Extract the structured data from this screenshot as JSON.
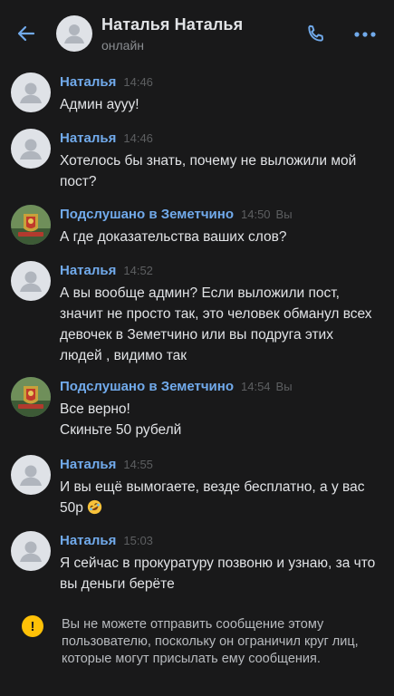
{
  "header": {
    "title": "Наталья Наталья",
    "status": "онлайн"
  },
  "colors": {
    "background": "#19191a",
    "author": "#71aaeb",
    "text": "#e1e3e6",
    "muted": "#5d5f61",
    "warning": "#ffc107"
  },
  "messages": [
    {
      "author": "Наталья",
      "time": "14:46",
      "you": "",
      "text": "Админ аууу!"
    },
    {
      "author": "Наталья",
      "time": "14:46",
      "you": "",
      "text": "Хотелось бы знать, почему не выложили мой пост?"
    },
    {
      "author": "Подслушано в Земетчино",
      "time": "14:50",
      "you": "Вы",
      "text": "А где доказательства ваших слов?"
    },
    {
      "author": "Наталья",
      "time": "14:52",
      "you": "",
      "text": "А вы вообще админ? Если выложили пост, значит не просто так, это человек обманул всех девочек в Земетчино или вы подруга этих людей , видимо так"
    },
    {
      "author": "Подслушано в Земетчино",
      "time": "14:54",
      "you": "Вы",
      "text": "Все верно!\nСкиньте 50 рубелй"
    },
    {
      "author": "Наталья",
      "time": "14:55",
      "you": "",
      "text": "И вы ещё вымогаете, везде бесплатно, а у вас 50р",
      "emoji": "rolling-on-floor-laughing-emoji"
    },
    {
      "author": "Наталья",
      "time": "15:03",
      "you": "",
      "text": "Я сейчас в прокуратуру позвоню и узнаю, за что вы деньги берёте"
    }
  ],
  "notice": {
    "icon": "!",
    "text": "Вы не можете отправить сообщение этому пользователю, поскольку он ограничил круг лиц, которые могут присылать ему сообщения."
  }
}
